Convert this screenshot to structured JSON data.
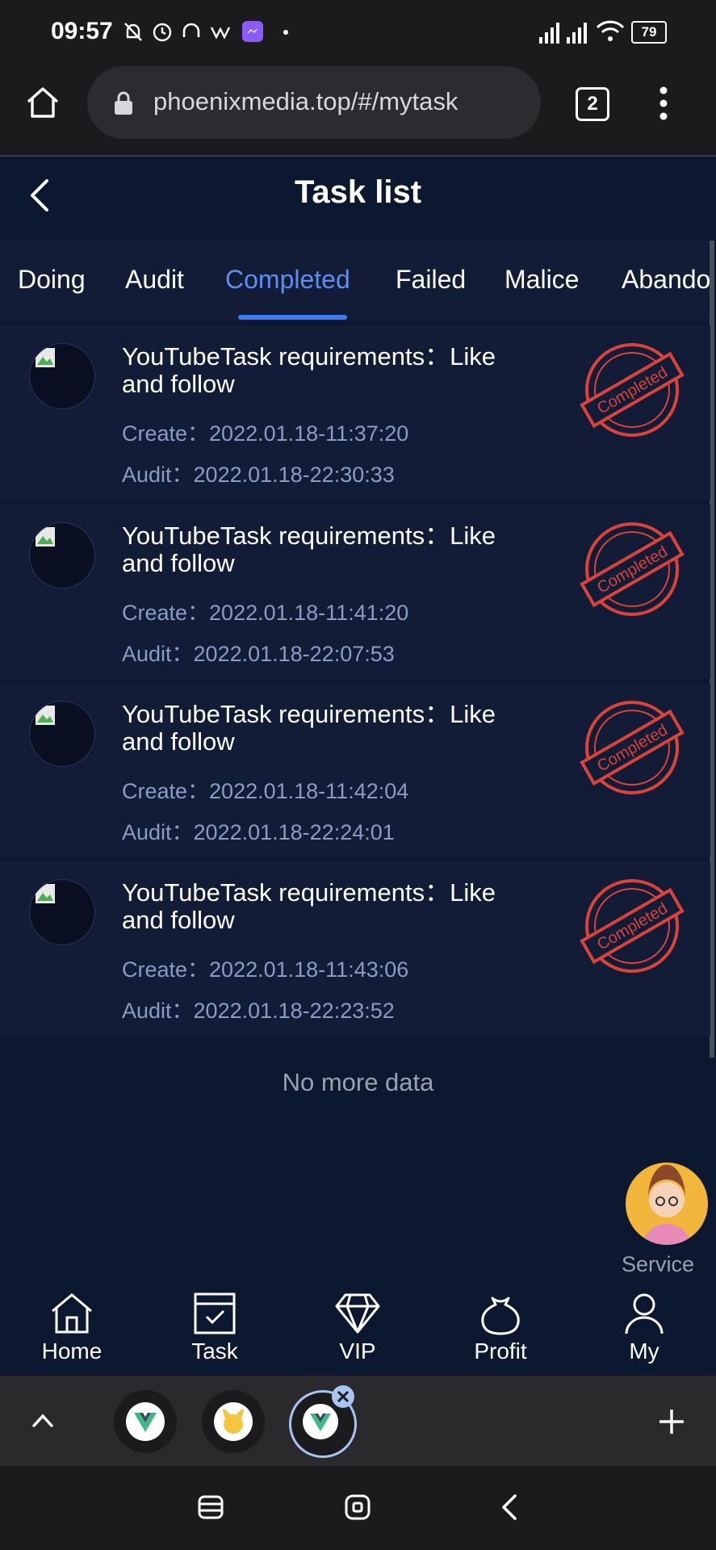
{
  "status_bar": {
    "time": "09:57",
    "battery": "79"
  },
  "browser": {
    "url": "phoenixmedia.top/#/mytask",
    "tab_count": "2"
  },
  "header": {
    "title": "Task list"
  },
  "tabs": [
    {
      "label": "Doing",
      "active": false
    },
    {
      "label": "Audit",
      "active": false
    },
    {
      "label": "Completed",
      "active": true
    },
    {
      "label": "Failed",
      "active": false
    },
    {
      "label": "Malice",
      "active": false
    },
    {
      "label": "Abando",
      "active": false
    }
  ],
  "tasks": [
    {
      "title": "YouTubeTask requirements：Like and follow",
      "create": "Create：2022.01.18-11:37:20",
      "audit": "Audit：2022.01.18-22:30:33",
      "stamp": "Completed"
    },
    {
      "title": "YouTubeTask requirements：Like and follow",
      "create": "Create：2022.01.18-11:41:20",
      "audit": "Audit：2022.01.18-22:07:53",
      "stamp": "Completed"
    },
    {
      "title": "YouTubeTask requirements：Like and follow",
      "create": "Create：2022.01.18-11:42:04",
      "audit": "Audit：2022.01.18-22:24:01",
      "stamp": "Completed"
    },
    {
      "title": "YouTubeTask requirements：Like and follow",
      "create": "Create：2022.01.18-11:43:06",
      "audit": "Audit：2022.01.18-22:23:52",
      "stamp": "Completed"
    }
  ],
  "footer_text": "No more data",
  "service": {
    "label": "Service"
  },
  "nav": [
    {
      "label": "Home",
      "icon": "home-icon"
    },
    {
      "label": "Task",
      "icon": "task-icon"
    },
    {
      "label": "VIP",
      "icon": "diamond-icon"
    },
    {
      "label": "Profit",
      "icon": "money-bag-icon"
    },
    {
      "label": "My",
      "icon": "user-icon"
    }
  ],
  "colors": {
    "accent": "#3b7cf0",
    "background": "#0c1730",
    "card": "#121c36",
    "stamp": "#d9433a"
  }
}
